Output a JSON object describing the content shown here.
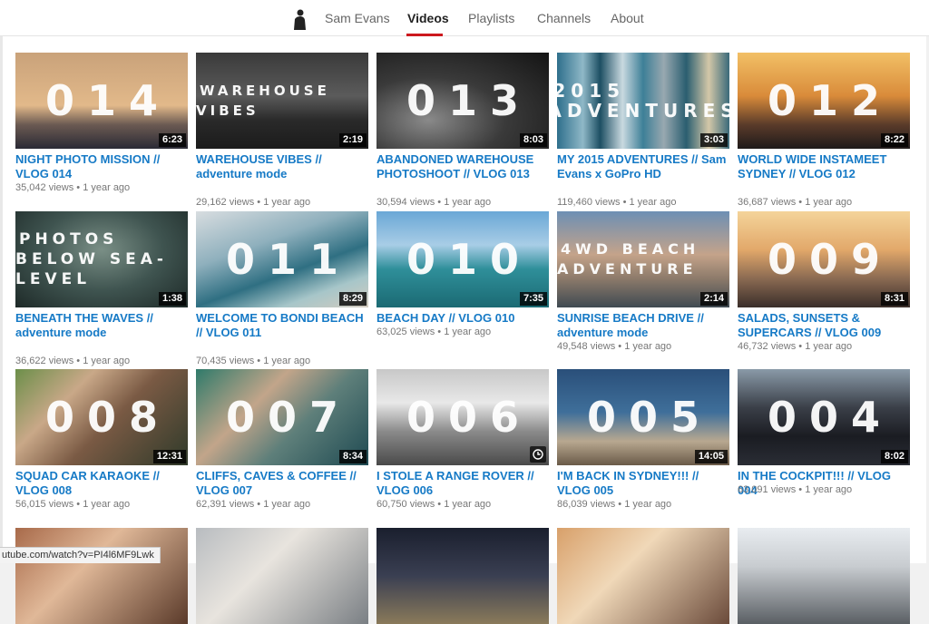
{
  "nav": {
    "channel_name": "Sam Evans",
    "tabs": [
      {
        "label": "Videos",
        "active": true
      },
      {
        "label": "Playlists"
      },
      {
        "label": "Channels"
      },
      {
        "label": "About"
      }
    ],
    "active_color": "#cc181e"
  },
  "videos": [
    {
      "title": "NIGHT PHOTO MISSION // VLOG 014",
      "views": "35,042 views",
      "age": "1 year ago",
      "duration": "6:23",
      "overlay": "014"
    },
    {
      "title": "WAREHOUSE VIBES // adventure mode",
      "views": "29,162 views",
      "age": "1 year ago",
      "duration": "2:19",
      "overlay": "WAREHOUSE VIBES"
    },
    {
      "title": "ABANDONED WAREHOUSE PHOTOSHOOT // VLOG 013",
      "views": "30,594 views",
      "age": "1 year ago",
      "duration": "8:03",
      "overlay": "013"
    },
    {
      "title": "MY 2015 ADVENTURES // Sam Evans x GoPro HD",
      "views": "119,460 views",
      "age": "1 year ago",
      "duration": "3:03",
      "overlay": "2015 ADVENTURES"
    },
    {
      "title": "WORLD WIDE INSTAMEET SYDNEY // VLOG 012",
      "views": "36,687 views",
      "age": "1 year ago",
      "duration": "8:22",
      "overlay": "012"
    },
    {
      "title": "BENEATH THE WAVES // adventure mode",
      "views": "36,622 views",
      "age": "1 year ago",
      "duration": "1:38",
      "overlay": "PHOTOS BELOW SEA-LEVEL"
    },
    {
      "title": "WELCOME TO BONDI BEACH // VLOG 011",
      "views": "70,435 views",
      "age": "1 year ago",
      "duration": "8:29",
      "overlay": "011"
    },
    {
      "title": "BEACH DAY // VLOG 010",
      "views": "63,025 views",
      "age": "1 year ago",
      "duration": "7:35",
      "overlay": "010"
    },
    {
      "title": "SUNRISE BEACH DRIVE // adventure mode",
      "views": "49,548 views",
      "age": "1 year ago",
      "duration": "2:14",
      "overlay": "4WD BEACH ADVENTURE"
    },
    {
      "title": "SALADS, SUNSETS & SUPERCARS // VLOG 009",
      "views": "46,732 views",
      "age": "1 year ago",
      "duration": "8:31",
      "overlay": "009"
    },
    {
      "title": "SQUAD CAR KARAOKE // VLOG 008",
      "views": "56,015 views",
      "age": "1 year ago",
      "duration": "12:31",
      "overlay": "008"
    },
    {
      "title": "CLIFFS, CAVES & COFFEE // VLOG 007",
      "views": "62,391 views",
      "age": "1 year ago",
      "duration": "8:34",
      "overlay": "007"
    },
    {
      "title": "I STOLE A RANGE ROVER // VLOG 006",
      "views": "60,750 views",
      "age": "1 year ago",
      "duration": "",
      "overlay": "006"
    },
    {
      "title": "I'M BACK IN SYDNEY!!! // VLOG 005",
      "views": "86,039 views",
      "age": "1 year ago",
      "duration": "14:05",
      "overlay": "005"
    },
    {
      "title": "IN THE COCKPIT!!! // VLOG 004",
      "views": "63,091 views",
      "age": "1 year ago",
      "duration": "8:02",
      "overlay": "004"
    }
  ],
  "status_url": "utube.com/watch?v=PI4l6MF9Lwk"
}
